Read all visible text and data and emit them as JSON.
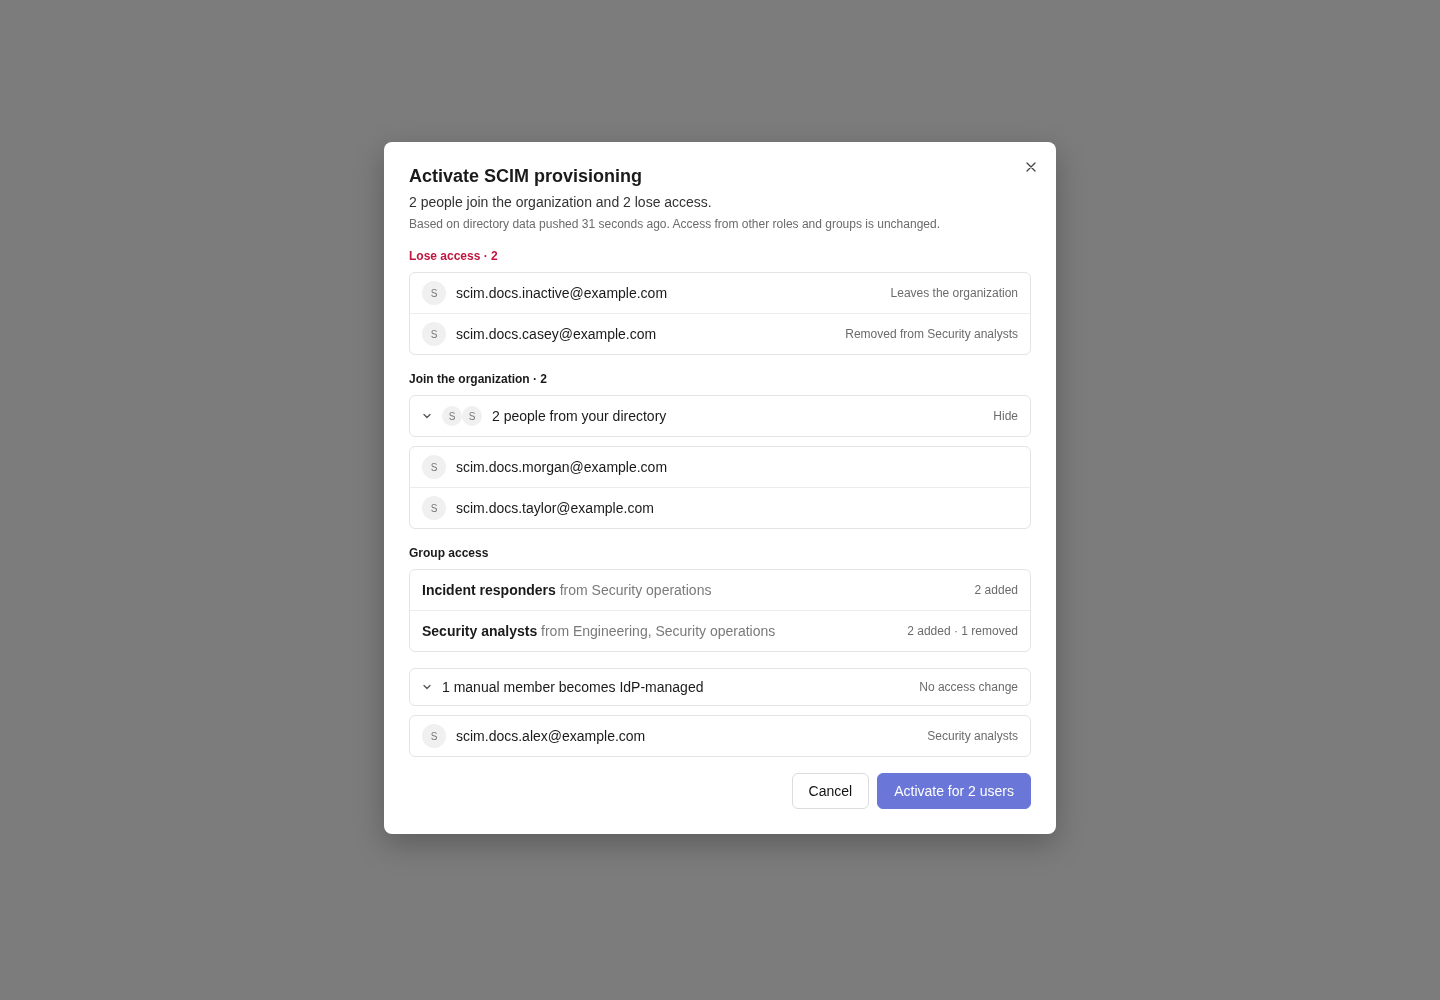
{
  "dialog": {
    "title": "Activate SCIM provisioning",
    "summary": "2 people join the organization and 2 lose access.",
    "note": "Based on directory data pushed 31 seconds ago. Access from other roles and groups is unchanged.",
    "lose_access": {
      "heading": "Lose access · 2",
      "rows": [
        {
          "avatar": "S",
          "email": "scim.docs.inactive@example.com",
          "detail": "Leaves the organization"
        },
        {
          "avatar": "S",
          "email": "scim.docs.casey@example.com",
          "detail": "Removed from Security analysts"
        }
      ]
    },
    "join": {
      "heading": "Join the organization · 2",
      "summary": {
        "avatars": [
          "S",
          "S"
        ],
        "label": "2 people from your directory",
        "action": "Hide",
        "expanded": true
      },
      "rows": [
        {
          "avatar": "S",
          "email": "scim.docs.morgan@example.com"
        },
        {
          "avatar": "S",
          "email": "scim.docs.taylor@example.com"
        }
      ]
    },
    "group_access": {
      "heading": "Group access",
      "rows": [
        {
          "name": "Incident responders",
          "source": "from Security operations",
          "change": "2 added"
        },
        {
          "name": "Security analysts",
          "source": "from Engineering, Security operations",
          "change": "2 added · 1 removed"
        }
      ]
    },
    "managed": {
      "label": "1 manual member becomes IdP-managed",
      "detail": "No access change",
      "expanded": true,
      "rows": [
        {
          "avatar": "S",
          "email": "scim.docs.alex@example.com",
          "detail": "Security analysts"
        }
      ]
    },
    "buttons": [
      {
        "label": "Cancel",
        "kind": "secondary"
      },
      {
        "label": "Activate for 2 users",
        "kind": "primary"
      }
    ]
  }
}
